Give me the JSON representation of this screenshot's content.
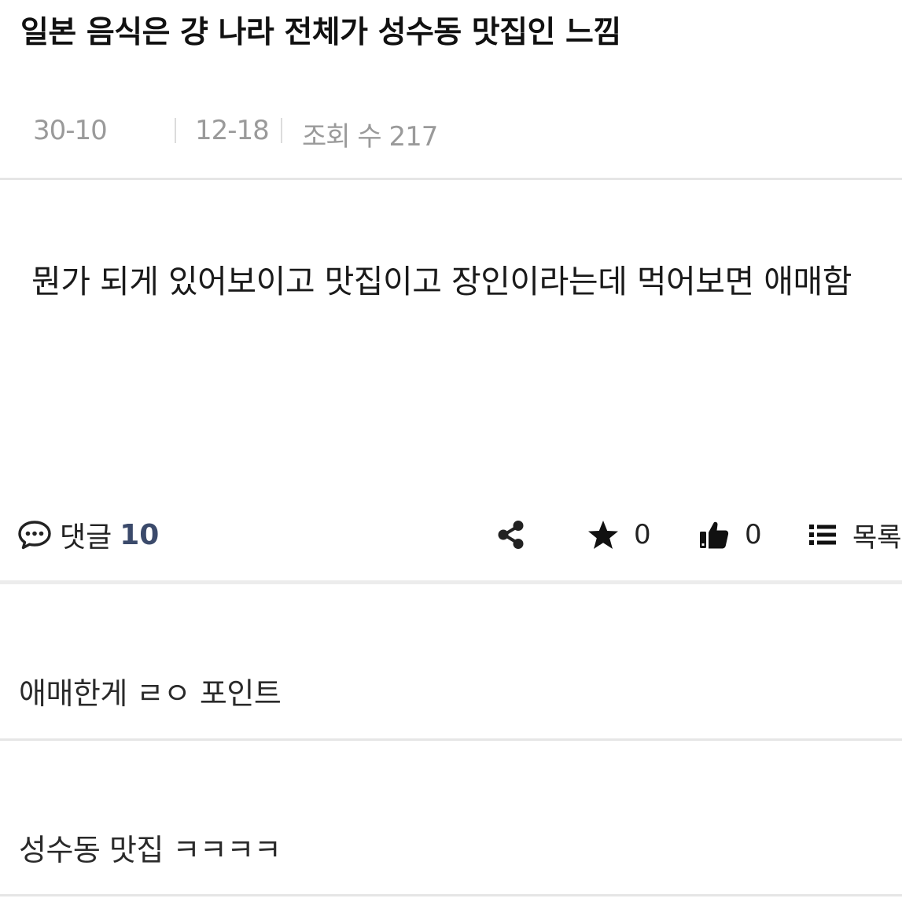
{
  "post": {
    "title": "일본 음식은 걍 나라 전체가 성수동 맛집인 느낌",
    "author": "30-10",
    "date": "12-18",
    "views": "조회 수 217",
    "body": "뭔가 되게 있어보이고 맛집이고 장인이라는데 먹어보면 애매함"
  },
  "actions": {
    "comment_label": "댓글",
    "comment_count": "10",
    "star_count": "0",
    "like_count": "0",
    "list_label": "목록"
  },
  "icons": {
    "comment": "comment-icon",
    "share": "share-icon",
    "star": "star-icon",
    "like": "thumbs-up-icon",
    "list": "list-icon"
  },
  "colors": {
    "accent": "#3b4a6b",
    "meta_text": "#9a9a9a",
    "divider": "#e6e6e6"
  },
  "comments": [
    {
      "text": "애매한게 ㄹㅇ 포인트"
    },
    {
      "text": "성수동 맛집 ㅋㅋㅋㅋ"
    }
  ]
}
